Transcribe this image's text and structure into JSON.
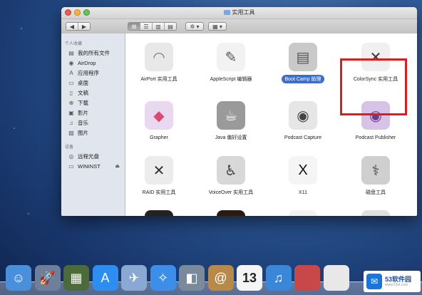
{
  "window": {
    "title": "实用工具"
  },
  "toolbar": {
    "back": "◀",
    "forward": "▶",
    "views": [
      "⊞",
      "☰",
      "▥",
      "▤"
    ],
    "action": "✲ ▾",
    "arrange": "▦ ▾"
  },
  "sidebar": {
    "favorites_header": "个人收藏",
    "favorites": [
      {
        "label": "我的所有文件",
        "icon": "files-icon",
        "glyph": "▤"
      },
      {
        "label": "AirDrop",
        "icon": "airdrop-icon",
        "glyph": "◉"
      },
      {
        "label": "应用程序",
        "icon": "applications-icon",
        "glyph": "A"
      },
      {
        "label": "桌面",
        "icon": "desktop-icon",
        "glyph": "▭"
      },
      {
        "label": "文稿",
        "icon": "documents-icon",
        "glyph": "▯"
      },
      {
        "label": "下载",
        "icon": "downloads-icon",
        "glyph": "⊕"
      },
      {
        "label": "影片",
        "icon": "movies-icon",
        "glyph": "▣"
      },
      {
        "label": "音乐",
        "icon": "music-icon",
        "glyph": "♫"
      },
      {
        "label": "图片",
        "icon": "pictures-icon",
        "glyph": "▨"
      }
    ],
    "devices_header": "设备",
    "devices": [
      {
        "label": "远程光盘",
        "icon": "disc-icon",
        "glyph": "◎"
      },
      {
        "label": "WININST",
        "icon": "drive-icon",
        "glyph": "▭",
        "eject": "⏏"
      }
    ]
  },
  "apps": [
    {
      "label": "AirPort 实用工具",
      "icon": "airport-icon",
      "glyph": "◠",
      "color": "#e8e8e8",
      "fg": "#777"
    },
    {
      "label": "AppleScript 编辑器",
      "icon": "applescript-icon",
      "glyph": "✎",
      "color": "#f2f2f2",
      "fg": "#555"
    },
    {
      "label": "Boot Camp 助理",
      "icon": "bootcamp-icon",
      "glyph": "▤",
      "color": "#c9c9c9",
      "fg": "#555",
      "selected": true
    },
    {
      "label": "ColorSync 实用工具",
      "icon": "colorsync-icon",
      "glyph": "✕",
      "color": "#f0f0f0",
      "fg": "#333"
    },
    {
      "label": "Grapher",
      "icon": "grapher-icon",
      "glyph": "◆",
      "color": "#e8d9f0",
      "fg": "#d94c6e"
    },
    {
      "label": "Java 偏好设置",
      "icon": "java-icon",
      "glyph": "☕",
      "color": "#9a9a9a",
      "fg": "#fff"
    },
    {
      "label": "Podcast Capture",
      "icon": "podcast-capture-icon",
      "glyph": "◉",
      "color": "#e6e6e6",
      "fg": "#444"
    },
    {
      "label": "Podcast Publisher",
      "icon": "podcast-publisher-icon",
      "glyph": "◉",
      "color": "#d6c3e6",
      "fg": "#6a3c8e"
    },
    {
      "label": "RAID 实用工具",
      "icon": "raid-icon",
      "glyph": "✕",
      "color": "#ececec",
      "fg": "#333"
    },
    {
      "label": "VoiceOver 实用工具",
      "icon": "voiceover-icon",
      "glyph": "♿",
      "color": "#d8d8d8",
      "fg": "#444"
    },
    {
      "label": "X11",
      "icon": "x11-icon",
      "glyph": "X",
      "color": "#f5f5f5",
      "fg": "#111"
    },
    {
      "label": "磁盘工具",
      "icon": "disk-utility-icon",
      "glyph": "⚕",
      "color": "#cfcfcf",
      "fg": "#444"
    },
    {
      "label": "",
      "icon": "activity-monitor-icon",
      "glyph": "",
      "color": "#222",
      "fg": "#3c3"
    },
    {
      "label": "",
      "icon": "console-icon",
      "glyph": "",
      "color": "#2a1a10",
      "fg": "#e0a040"
    },
    {
      "label": "",
      "icon": "system-info-icon",
      "glyph": "",
      "color": "#f2f2f2",
      "fg": "#888"
    },
    {
      "label": "",
      "icon": "migration-icon",
      "glyph": "",
      "color": "#e0e0e0",
      "fg": "#666"
    }
  ],
  "dock": [
    {
      "icon": "finder-icon",
      "glyph": "☺",
      "color": "#4a8fdc"
    },
    {
      "icon": "launchpad-icon",
      "glyph": "🚀",
      "color": "#6f7f99"
    },
    {
      "icon": "mission-control-icon",
      "glyph": "▦",
      "color": "#4d6b3a"
    },
    {
      "icon": "app-store-icon",
      "glyph": "A",
      "color": "#2d8ef0"
    },
    {
      "icon": "preview-icon",
      "glyph": "✈",
      "color": "#8aa8d4"
    },
    {
      "icon": "safari-icon",
      "glyph": "✧",
      "color": "#3c8ee8"
    },
    {
      "icon": "facetime-icon",
      "glyph": "◧",
      "color": "#7a8a9c"
    },
    {
      "icon": "contacts-icon",
      "glyph": "@",
      "color": "#b88a4a"
    },
    {
      "icon": "calendar-icon",
      "glyph": "13",
      "color": "#f5f5f5"
    },
    {
      "icon": "itunes-icon",
      "glyph": "♫",
      "color": "#3a86d9"
    },
    {
      "icon": "photobooth-icon",
      "glyph": "",
      "color": "#c8484a"
    },
    {
      "icon": "document-icon",
      "glyph": "",
      "color": "#e8e8e8"
    }
  ],
  "watermark": {
    "brand": "53软件园",
    "sub": "www.53xt.com",
    "mark": "✉"
  }
}
